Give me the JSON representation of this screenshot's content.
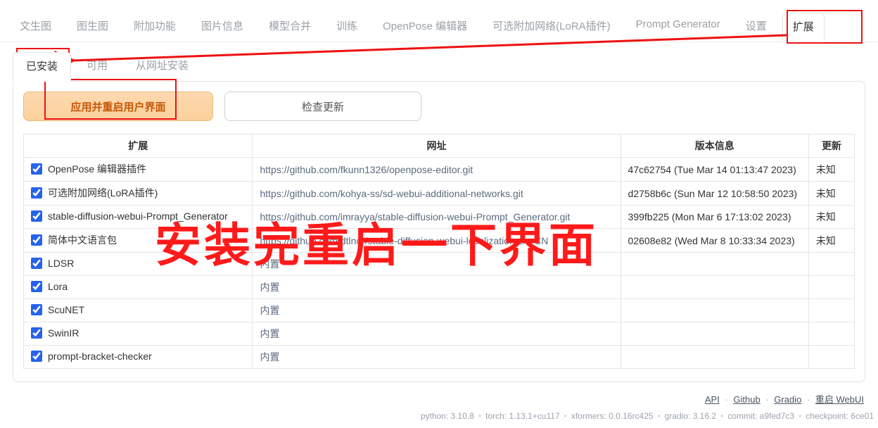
{
  "main_tabs": [
    {
      "label": "文生图"
    },
    {
      "label": "图生图"
    },
    {
      "label": "附加功能"
    },
    {
      "label": "图片信息"
    },
    {
      "label": "模型合并"
    },
    {
      "label": "训练"
    },
    {
      "label": "OpenPose 编辑器"
    },
    {
      "label": "可选附加网络(LoRA插件)"
    },
    {
      "label": "Prompt Generator"
    },
    {
      "label": "设置"
    },
    {
      "label": "扩展",
      "active": true
    }
  ],
  "sub_tabs": [
    {
      "label": "已安装",
      "active": true
    },
    {
      "label": "可用"
    },
    {
      "label": "从网址安装"
    }
  ],
  "buttons": {
    "apply_restart": "应用并重启用户界面",
    "check_updates": "检查更新"
  },
  "table": {
    "head": {
      "ext": "扩展",
      "url": "网址",
      "ver": "版本信息",
      "upd": "更新"
    },
    "rows": [
      {
        "checked": true,
        "name": "OpenPose 编辑器插件",
        "url": "https://github.com/fkunn1326/openpose-editor.git",
        "ver": "47c62754 (Tue Mar 14 01:13:47 2023)",
        "upd": "未知"
      },
      {
        "checked": true,
        "name": "可选附加网络(LoRA插件)",
        "url": "https://github.com/kohya-ss/sd-webui-additional-networks.git",
        "ver": "d2758b6c (Sun Mar 12 10:58:50 2023)",
        "upd": "未知"
      },
      {
        "checked": true,
        "name": "stable-diffusion-webui-Prompt_Generator",
        "url": "https://github.com/imrayya/stable-diffusion-webui-Prompt_Generator.git",
        "ver": "399fb225 (Mon Mar 6 17:13:02 2023)",
        "upd": "未知"
      },
      {
        "checked": true,
        "name": "简体中文语言包",
        "url": "https://github.com/dtlnor/stable-diffusion-webui-localization-zh_CN",
        "ver": "02608e82 (Wed Mar 8 10:33:34 2023)",
        "upd": "未知"
      },
      {
        "checked": true,
        "name": "LDSR",
        "url": "内置",
        "ver": "",
        "upd": ""
      },
      {
        "checked": true,
        "name": "Lora",
        "url": "内置",
        "ver": "",
        "upd": ""
      },
      {
        "checked": true,
        "name": "ScuNET",
        "url": "内置",
        "ver": "",
        "upd": ""
      },
      {
        "checked": true,
        "name": "SwinIR",
        "url": "内置",
        "ver": "",
        "upd": ""
      },
      {
        "checked": true,
        "name": "prompt-bracket-checker",
        "url": "内置",
        "ver": "",
        "upd": ""
      }
    ]
  },
  "footer": {
    "links": [
      "API",
      "Github",
      "Gradio",
      "重启 WebUI"
    ],
    "metrics": [
      {
        "k": "python",
        "v": "3.10.8"
      },
      {
        "k": "torch",
        "v": "1.13.1+cu117"
      },
      {
        "k": "xformers",
        "v": "0.0.16rc425"
      },
      {
        "k": "gradio",
        "v": "3.16.2"
      },
      {
        "k": "commit",
        "v": "a9fed7c3"
      },
      {
        "k": "checkpoint",
        "v": "6ce01"
      }
    ]
  },
  "annotation_text": "安装完重启一下界面"
}
